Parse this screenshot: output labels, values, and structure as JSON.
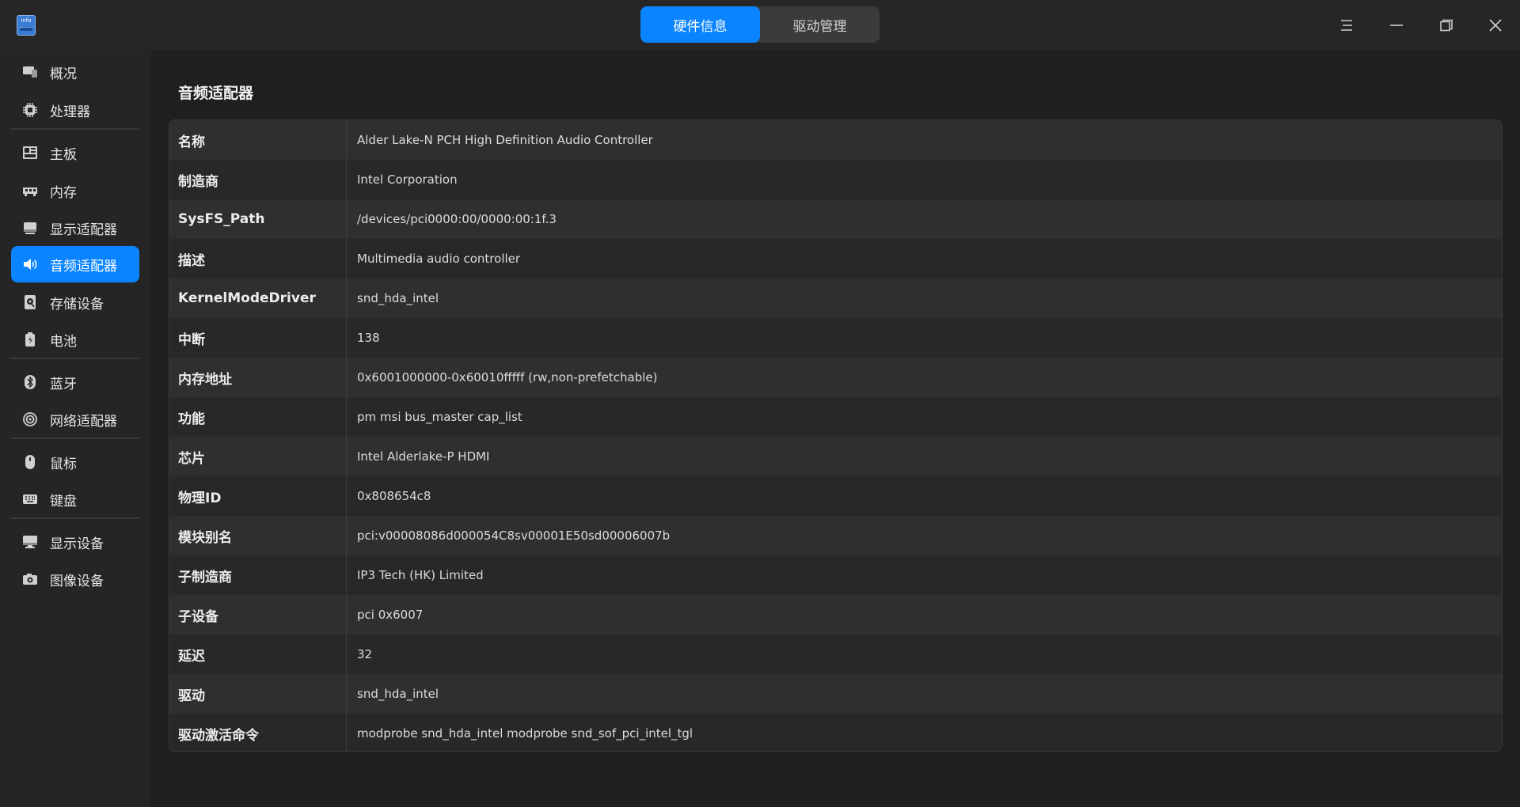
{
  "app": {
    "icon_label": "info",
    "tabs": [
      {
        "label": "硬件信息",
        "active": true
      },
      {
        "label": "驱动管理",
        "active": false
      }
    ],
    "accent_color": "#0a84ff"
  },
  "window_controls": [
    "menu-icon",
    "minimize-icon",
    "restore-icon",
    "close-icon"
  ],
  "sidebar": {
    "items": [
      {
        "label": "概况",
        "icon": "overview-icon"
      },
      {
        "label": "处理器",
        "icon": "cpu-icon"
      },
      {
        "label": "主板",
        "icon": "motherboard-icon"
      },
      {
        "label": "内存",
        "icon": "memory-icon"
      },
      {
        "label": "显示适配器",
        "icon": "display-adapter-icon"
      },
      {
        "label": "音频适配器",
        "icon": "speaker-icon",
        "active": true
      },
      {
        "label": "存储设备",
        "icon": "storage-icon"
      },
      {
        "label": "电池",
        "icon": "battery-icon"
      },
      {
        "label": "蓝牙",
        "icon": "bluetooth-icon"
      },
      {
        "label": "网络适配器",
        "icon": "network-icon"
      },
      {
        "label": "鼠标",
        "icon": "mouse-icon"
      },
      {
        "label": "键盘",
        "icon": "keyboard-icon"
      },
      {
        "label": "显示设备",
        "icon": "monitor-icon"
      },
      {
        "label": "图像设备",
        "icon": "camera-icon"
      }
    ]
  },
  "main": {
    "title": "音频适配器",
    "rows": [
      {
        "key": "名称",
        "value": "Alder Lake-N PCH High Definition Audio Controller"
      },
      {
        "key": "制造商",
        "value": "Intel Corporation"
      },
      {
        "key": "SysFS_Path",
        "value": "/devices/pci0000:00/0000:00:1f.3"
      },
      {
        "key": "描述",
        "value": "Multimedia audio controller"
      },
      {
        "key": "KernelModeDriver",
        "value": "snd_hda_intel"
      },
      {
        "key": "中断",
        "value": "138"
      },
      {
        "key": "内存地址",
        "value": "0x6001000000-0x60010fffff (rw,non-prefetchable)"
      },
      {
        "key": "功能",
        "value": "pm msi bus_master cap_list"
      },
      {
        "key": "芯片",
        "value": "Intel Alderlake-P HDMI"
      },
      {
        "key": "物理ID",
        "value": "0x808654c8"
      },
      {
        "key": "模块别名",
        "value": "pci:v00008086d000054C8sv00001E50sd00006007b"
      },
      {
        "key": "子制造商",
        "value": "IP3 Tech (HK) Limited"
      },
      {
        "key": "子设备",
        "value": "pci 0x6007"
      },
      {
        "key": "延迟",
        "value": "32"
      },
      {
        "key": "驱动",
        "value": "snd_hda_intel"
      },
      {
        "key": "驱动激活命令",
        "value": "modprobe snd_hda_intel modprobe snd_sof_pci_intel_tgl"
      }
    ]
  }
}
